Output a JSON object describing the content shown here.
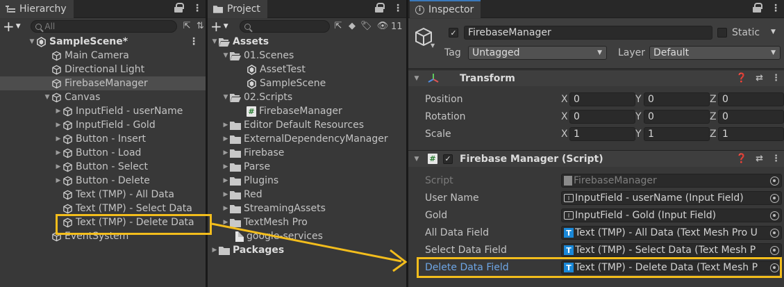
{
  "hierarchy": {
    "tab_label": "Hierarchy",
    "search_placeholder": "All",
    "scene_name": "SampleScene*",
    "items": [
      {
        "label": "Main Camera"
      },
      {
        "label": "Directional Light"
      },
      {
        "label": "FirebaseManager"
      },
      {
        "label": "Canvas"
      },
      {
        "label": "InputField - userName"
      },
      {
        "label": "InputField - Gold"
      },
      {
        "label": "Button - Insert"
      },
      {
        "label": "Button - Load"
      },
      {
        "label": "Button - Select"
      },
      {
        "label": "Button - Delete"
      },
      {
        "label": "Text (TMP) - All Data"
      },
      {
        "label": "Text (TMP) - Select Data"
      },
      {
        "label": "Text (TMP) - Delete Data"
      },
      {
        "label": "EventSystem"
      }
    ]
  },
  "project": {
    "tab_label": "Project",
    "hidden_count": "11",
    "items": [
      {
        "label": "Assets"
      },
      {
        "label": "01.Scenes"
      },
      {
        "label": "AssetTest"
      },
      {
        "label": "SampleScene"
      },
      {
        "label": "02.Scripts"
      },
      {
        "label": "FirebaseManager"
      },
      {
        "label": "Editor Default Resources"
      },
      {
        "label": "ExternalDependencyManager"
      },
      {
        "label": "Firebase"
      },
      {
        "label": "Parse"
      },
      {
        "label": "Plugins"
      },
      {
        "label": "Red"
      },
      {
        "label": "StreamingAssets"
      },
      {
        "label": "TextMesh Pro"
      },
      {
        "label": "google-services"
      },
      {
        "label": "Packages"
      }
    ]
  },
  "inspector": {
    "tab_label": "Inspector",
    "object_name": "FirebaseManager",
    "static_label": "Static",
    "tag_label": "Tag",
    "tag_value": "Untagged",
    "layer_label": "Layer",
    "layer_value": "Default",
    "transform": {
      "title": "Transform",
      "position_label": "Position",
      "rotation_label": "Rotation",
      "scale_label": "Scale",
      "axis_x": "X",
      "axis_y": "Y",
      "axis_z": "Z",
      "position": [
        "0",
        "0",
        "0"
      ],
      "rotation": [
        "0",
        "0",
        "0"
      ],
      "scale": [
        "1",
        "1",
        "1"
      ]
    },
    "script_component": {
      "title": "Firebase Manager (Script)",
      "fields": [
        {
          "label": "Script",
          "value": "FirebaseManager"
        },
        {
          "label": "User Name",
          "value": "InputField - userName (Input Field)"
        },
        {
          "label": "Gold",
          "value": "InputField - Gold (Input Field)"
        },
        {
          "label": "All Data Field",
          "value": "Text (TMP) - All Data (Text Mesh Pro U"
        },
        {
          "label": "Select Data Field",
          "value": "Text (TMP) - Select Data (Text Mesh P"
        },
        {
          "label": "Delete Data Field",
          "value": "Text (TMP) - Delete Data (Text Mesh P"
        }
      ]
    }
  },
  "colors": {
    "highlight": "#f3bd1c",
    "selection_label": "#6ea6e6",
    "tmp_icon": "#1a88d8"
  }
}
